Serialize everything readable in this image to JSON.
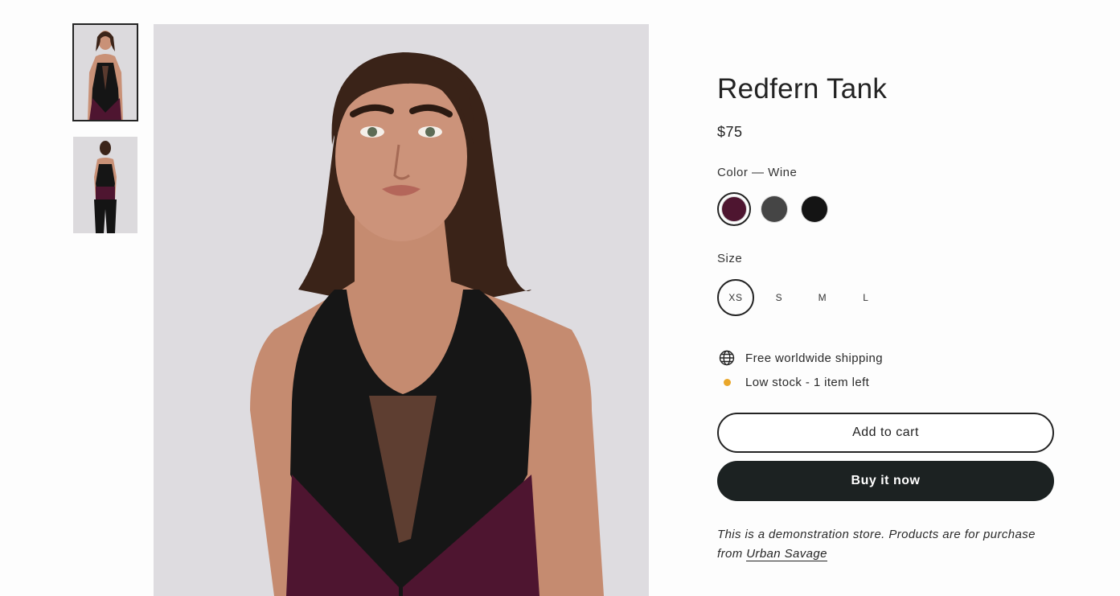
{
  "gallery": {
    "thumbnails": [
      {
        "icon": "model-front-image",
        "selected": true
      },
      {
        "icon": "model-back-image",
        "selected": false
      }
    ],
    "main_image_icon": "model-front-image"
  },
  "product": {
    "title": "Redfern Tank",
    "price": "$75",
    "color": {
      "label": "Color — Wine",
      "swatches": [
        {
          "name": "Wine",
          "hex": "#4e1530",
          "selected": true
        },
        {
          "name": "Charcoal",
          "hex": "#454545",
          "selected": false
        },
        {
          "name": "Black",
          "hex": "#141414",
          "selected": false
        }
      ]
    },
    "size": {
      "label": "Size",
      "options": [
        "XS",
        "S",
        "M",
        "L"
      ],
      "selected": "XS"
    },
    "shipping_text": "Free worldwide shipping",
    "stock_text": "Low stock - 1 item left",
    "stock_color": "#eaa72a",
    "add_to_cart_label": "Add to cart",
    "buy_now_label": "Buy it now",
    "note_text": "This is a demonstration store. Products are for purchase from",
    "note_link": "Urban Savage"
  }
}
